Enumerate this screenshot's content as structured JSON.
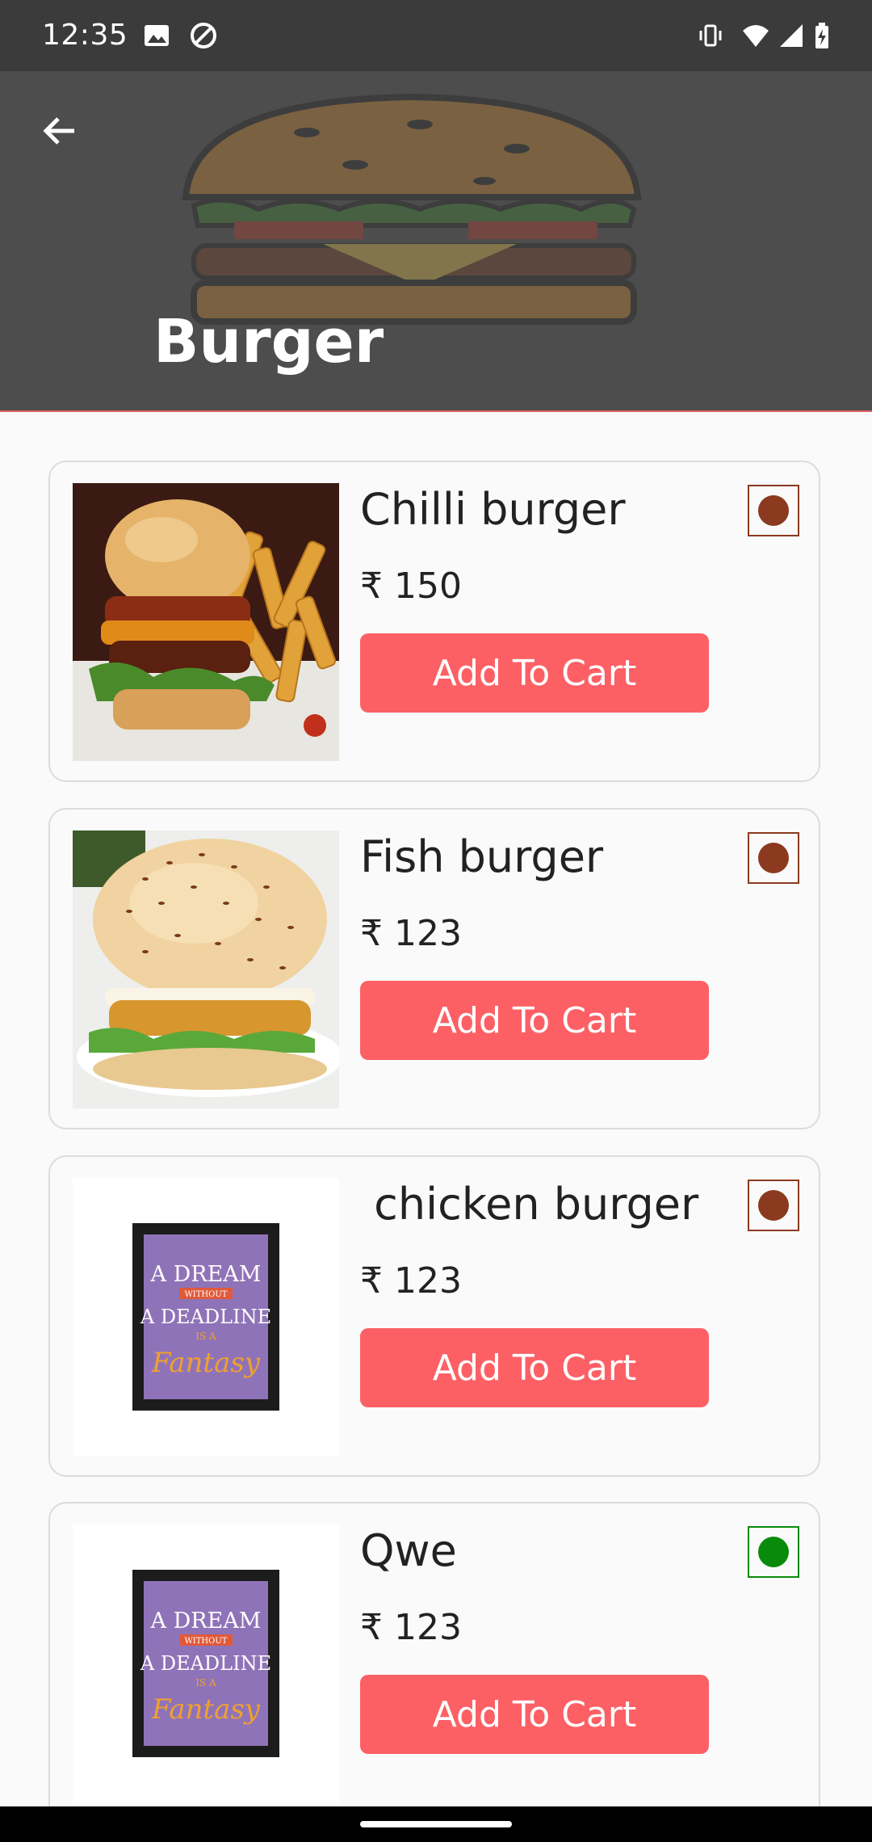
{
  "status_bar": {
    "time": "12:35",
    "icons": [
      "image-icon",
      "at-sign-icon",
      "vibrate-icon",
      "wifi-icon",
      "signal-icon",
      "battery-charging-icon"
    ]
  },
  "header": {
    "title": "Burger",
    "back_icon": "arrow-left-icon",
    "background_color": "#4d4d4d"
  },
  "colors": {
    "button": "#fc6065",
    "non_veg_marker": "#8b3a1f",
    "veg_marker": "#0a8a0a"
  },
  "items": [
    {
      "name": "Chilli burger",
      "price": "₹ 150",
      "button": "Add To Cart",
      "image": "chilli-burger-photo",
      "marker": "non-veg"
    },
    {
      "name": "Fish burger",
      "price": "₹ 123",
      "button": "Add To Cart",
      "image": "fish-burger-photo",
      "marker": "non-veg"
    },
    {
      "name": " chicken burger",
      "price": "₹ 123",
      "button": "Add To Cart",
      "image": "quote-poster",
      "marker": "non-veg"
    },
    {
      "name": "Qwe",
      "price": "₹ 123",
      "button": "Add To Cart",
      "image": "quote-poster",
      "marker": "veg"
    }
  ],
  "poster": {
    "line1": "A DREAM",
    "line2": "WITHOUT",
    "line3": "A DEADLINE",
    "line4": "IS A",
    "line5": "Fantasy"
  }
}
